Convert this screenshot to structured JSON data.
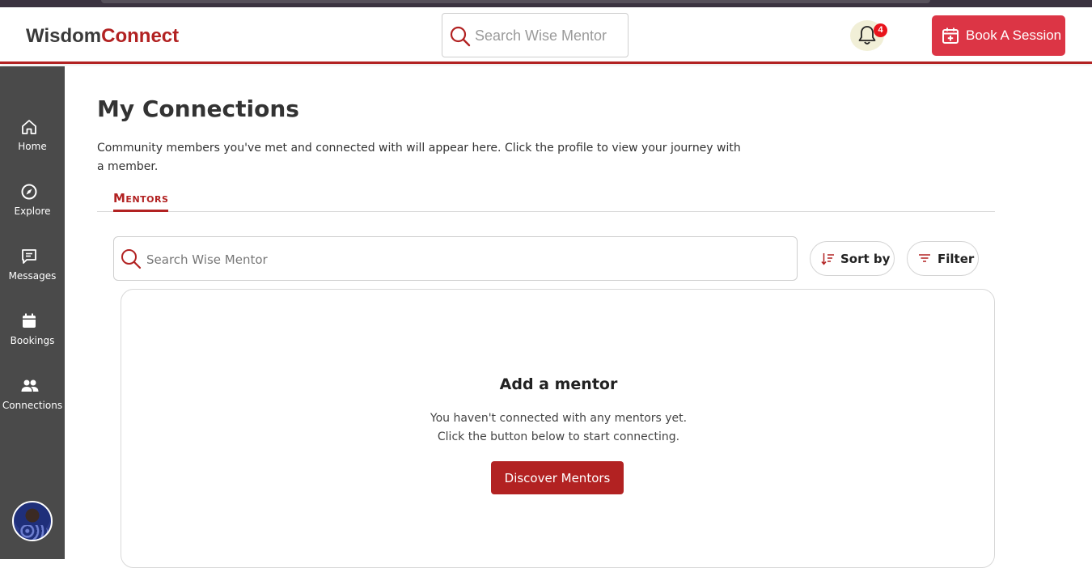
{
  "app": {
    "logo_part1": "Wisdom",
    "logo_part2": "Connect",
    "accent_color": "#b22222",
    "button_color": "#dc3545"
  },
  "header": {
    "search_placeholder": "Search Wise Mentor",
    "notification_count": "4",
    "book_label": "Book A Session",
    "bell_icon": "bell-icon",
    "book_icon": "calendar-plus-icon"
  },
  "sidebar": {
    "items": [
      {
        "label": "Home",
        "icon": "home-icon"
      },
      {
        "label": "Explore",
        "icon": "compass-icon"
      },
      {
        "label": "Messages",
        "icon": "message-icon"
      },
      {
        "label": "Bookings",
        "icon": "calendar-icon"
      },
      {
        "label": "Connections",
        "icon": "people-icon"
      }
    ]
  },
  "main": {
    "title": "My Connections",
    "description": "Community members you've met and connected with will appear here. Click the profile to view your journey with a member.",
    "tabs": [
      {
        "label": "Mentors",
        "active": true
      }
    ],
    "search_placeholder": "Search Wise Mentor",
    "sort_label": "Sort by",
    "filter_label": "Filter",
    "empty_state": {
      "title": "Add a mentor",
      "line1": "You haven't connected with any mentors yet.",
      "line2": "Click the button below to start connecting.",
      "button_label": "Discover Mentors"
    }
  }
}
